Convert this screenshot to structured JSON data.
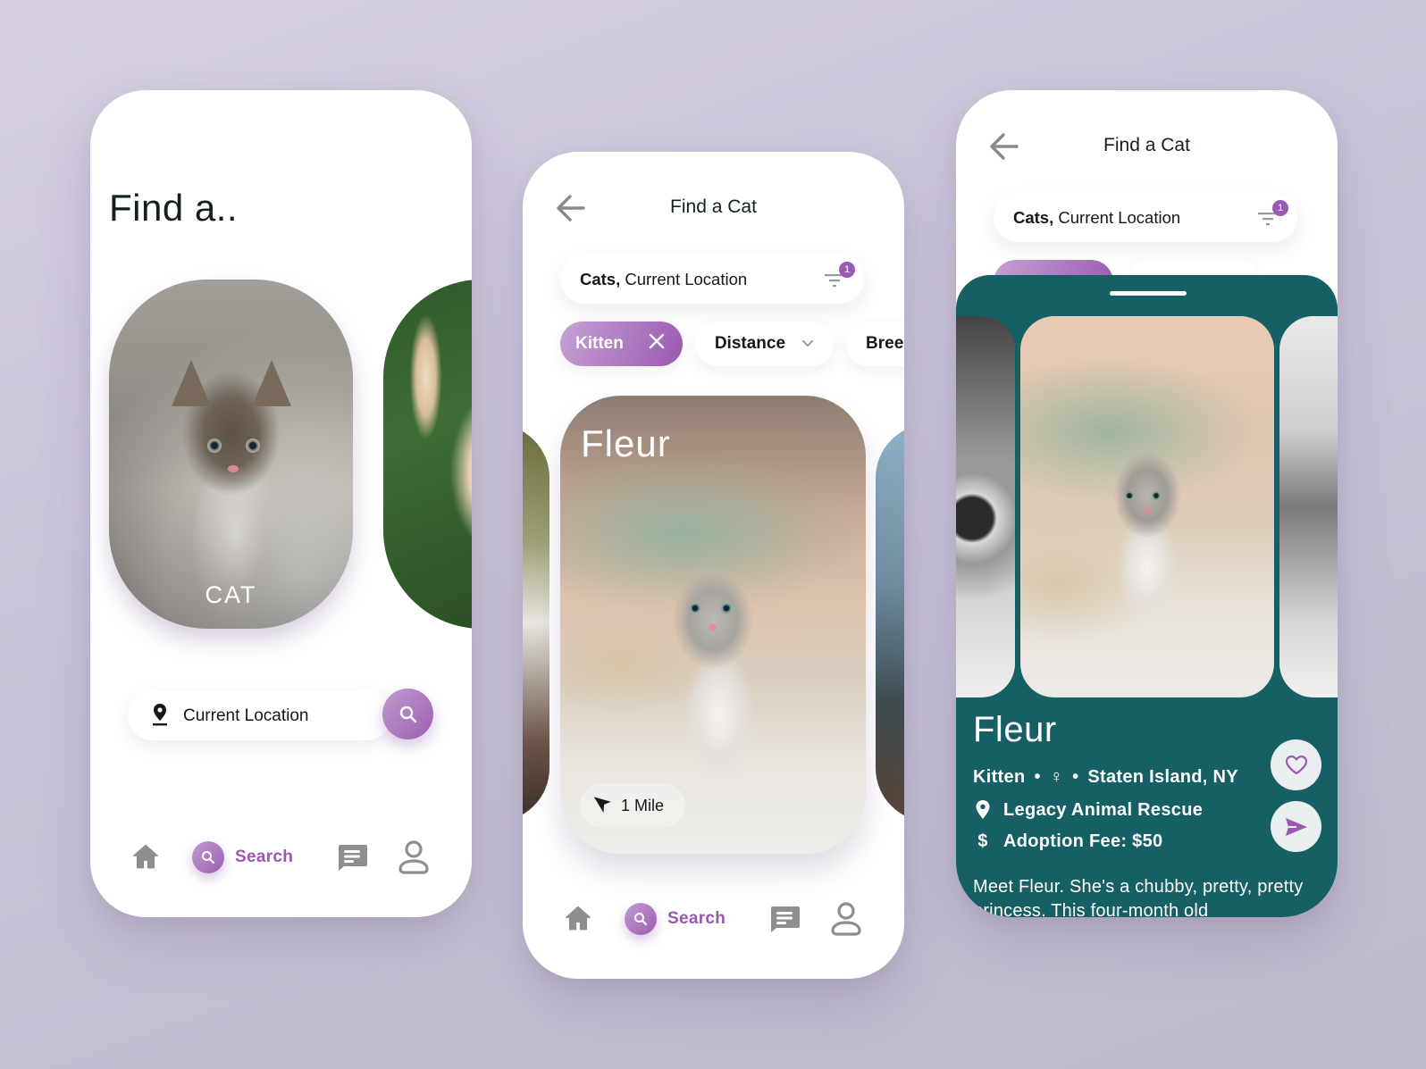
{
  "screens": {
    "home": {
      "title": "Find a..",
      "categories": [
        {
          "label": "CAT",
          "image": "tabby kitten on blanket"
        },
        {
          "label": "",
          "image": "fluffy cream cat on grass"
        }
      ],
      "location_field": {
        "value": "Current Location",
        "icon": "location-pin-icon"
      },
      "search_button": {
        "icon": "search-icon"
      }
    },
    "results": {
      "header": {
        "title": "Find a Cat",
        "back_icon": "arrow-left-icon"
      },
      "search": {
        "bold": "Cats,",
        "rest": " Current Location",
        "filter_count": "1"
      },
      "chips": [
        {
          "label": "Kitten",
          "active": true,
          "icon": "close-icon"
        },
        {
          "label": "Distance",
          "active": false,
          "icon": "chevron-down-icon"
        },
        {
          "label": "Breeds",
          "active": false
        }
      ],
      "card": {
        "name": "Fleur",
        "distance": "1 Mile",
        "image": "grey and white kitten on bed"
      }
    },
    "detail": {
      "header": {
        "title": "Find a Cat",
        "back_icon": "arrow-left-icon"
      },
      "search": {
        "bold": "Cats,",
        "rest": " Current Location",
        "filter_count": "1"
      },
      "pet": {
        "name": "Fleur",
        "age": "Kitten",
        "sex_symbol": "♀",
        "location": "Staten Island, NY",
        "shelter": "Legacy Animal Rescue",
        "fee": "Adoption Fee: $50",
        "description": "Meet Fleur. She's a chubby, pretty, pretty princess. This four-month old"
      }
    }
  },
  "bottom_nav": {
    "items": [
      {
        "name": "home",
        "icon": "home-icon"
      },
      {
        "name": "search",
        "icon": "search-icon",
        "label": "Search",
        "active": true
      },
      {
        "name": "messages",
        "icon": "chat-icon"
      },
      {
        "name": "profile",
        "icon": "user-icon"
      }
    ]
  },
  "colors": {
    "accent_purple": "#9b59b6",
    "accent_purple_light": "#c6a1d4",
    "sheet_teal": "#165f65",
    "icon_grey": "#8e8e8e",
    "text_dark": "#121a19",
    "background": "#cdc8d9"
  }
}
